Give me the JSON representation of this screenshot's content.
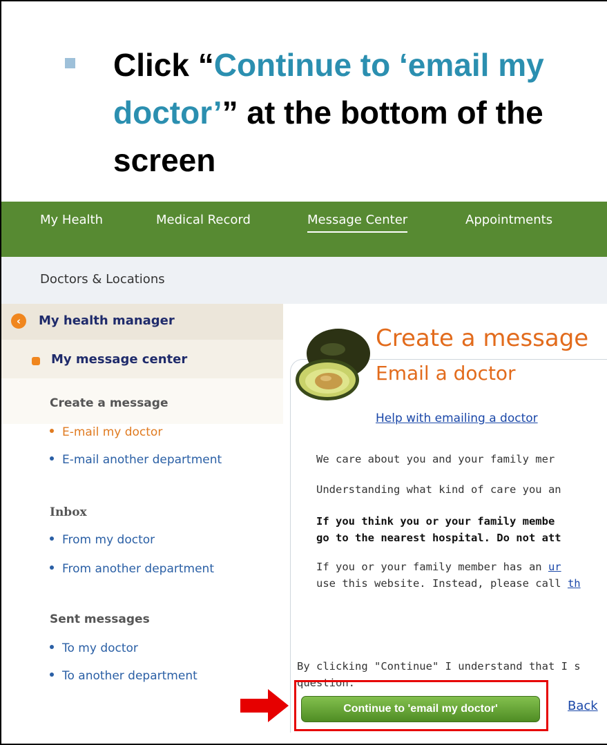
{
  "instruction": {
    "part1": "Click “",
    "highlight": "Continue to ‘email my doctor’",
    "part2": "” at the bottom of the screen"
  },
  "nav": {
    "items": [
      "My Health",
      "Medical Record",
      "Message Center",
      "Appointments"
    ],
    "active": "Message Center"
  },
  "subnav": {
    "item": "Doctors & Locations"
  },
  "sidebar": {
    "header": "My health manager",
    "subheader": "My message center",
    "sections": [
      {
        "title": "Create a message",
        "items": [
          "E-mail my doctor",
          "E-mail another department"
        ]
      },
      {
        "title": "Inbox",
        "items": [
          "From my doctor",
          "From another department"
        ]
      },
      {
        "title": "Sent messages",
        "items": [
          "To my doctor",
          "To another department"
        ]
      }
    ],
    "current_item": "E-mail my doctor"
  },
  "main": {
    "title": "Create a message",
    "subtitle": "Email a doctor",
    "help_link": "Help with emailing a doctor",
    "para1": "We care about you and your family mer",
    "para2": "Understanding what kind of care you an",
    "bold1": "If you think you or your family membe",
    "bold2": "go to the nearest hospital. Do not att",
    "para3a": "If you or your family member has an ",
    "para3a_link": "ur",
    "para3b": "use this website. Instead, please call ",
    "para3b_link": "th",
    "consent1": "By clicking \"Continue\" I understand that I s",
    "consent2": "question.",
    "continue_label": "Continue to 'email my doctor'",
    "back_label": "Back"
  },
  "colors": {
    "nav_green": "#578a32",
    "accent_orange": "#e26b1c",
    "highlight_red": "#e60000",
    "instruction_blue": "#2b8fb0"
  }
}
